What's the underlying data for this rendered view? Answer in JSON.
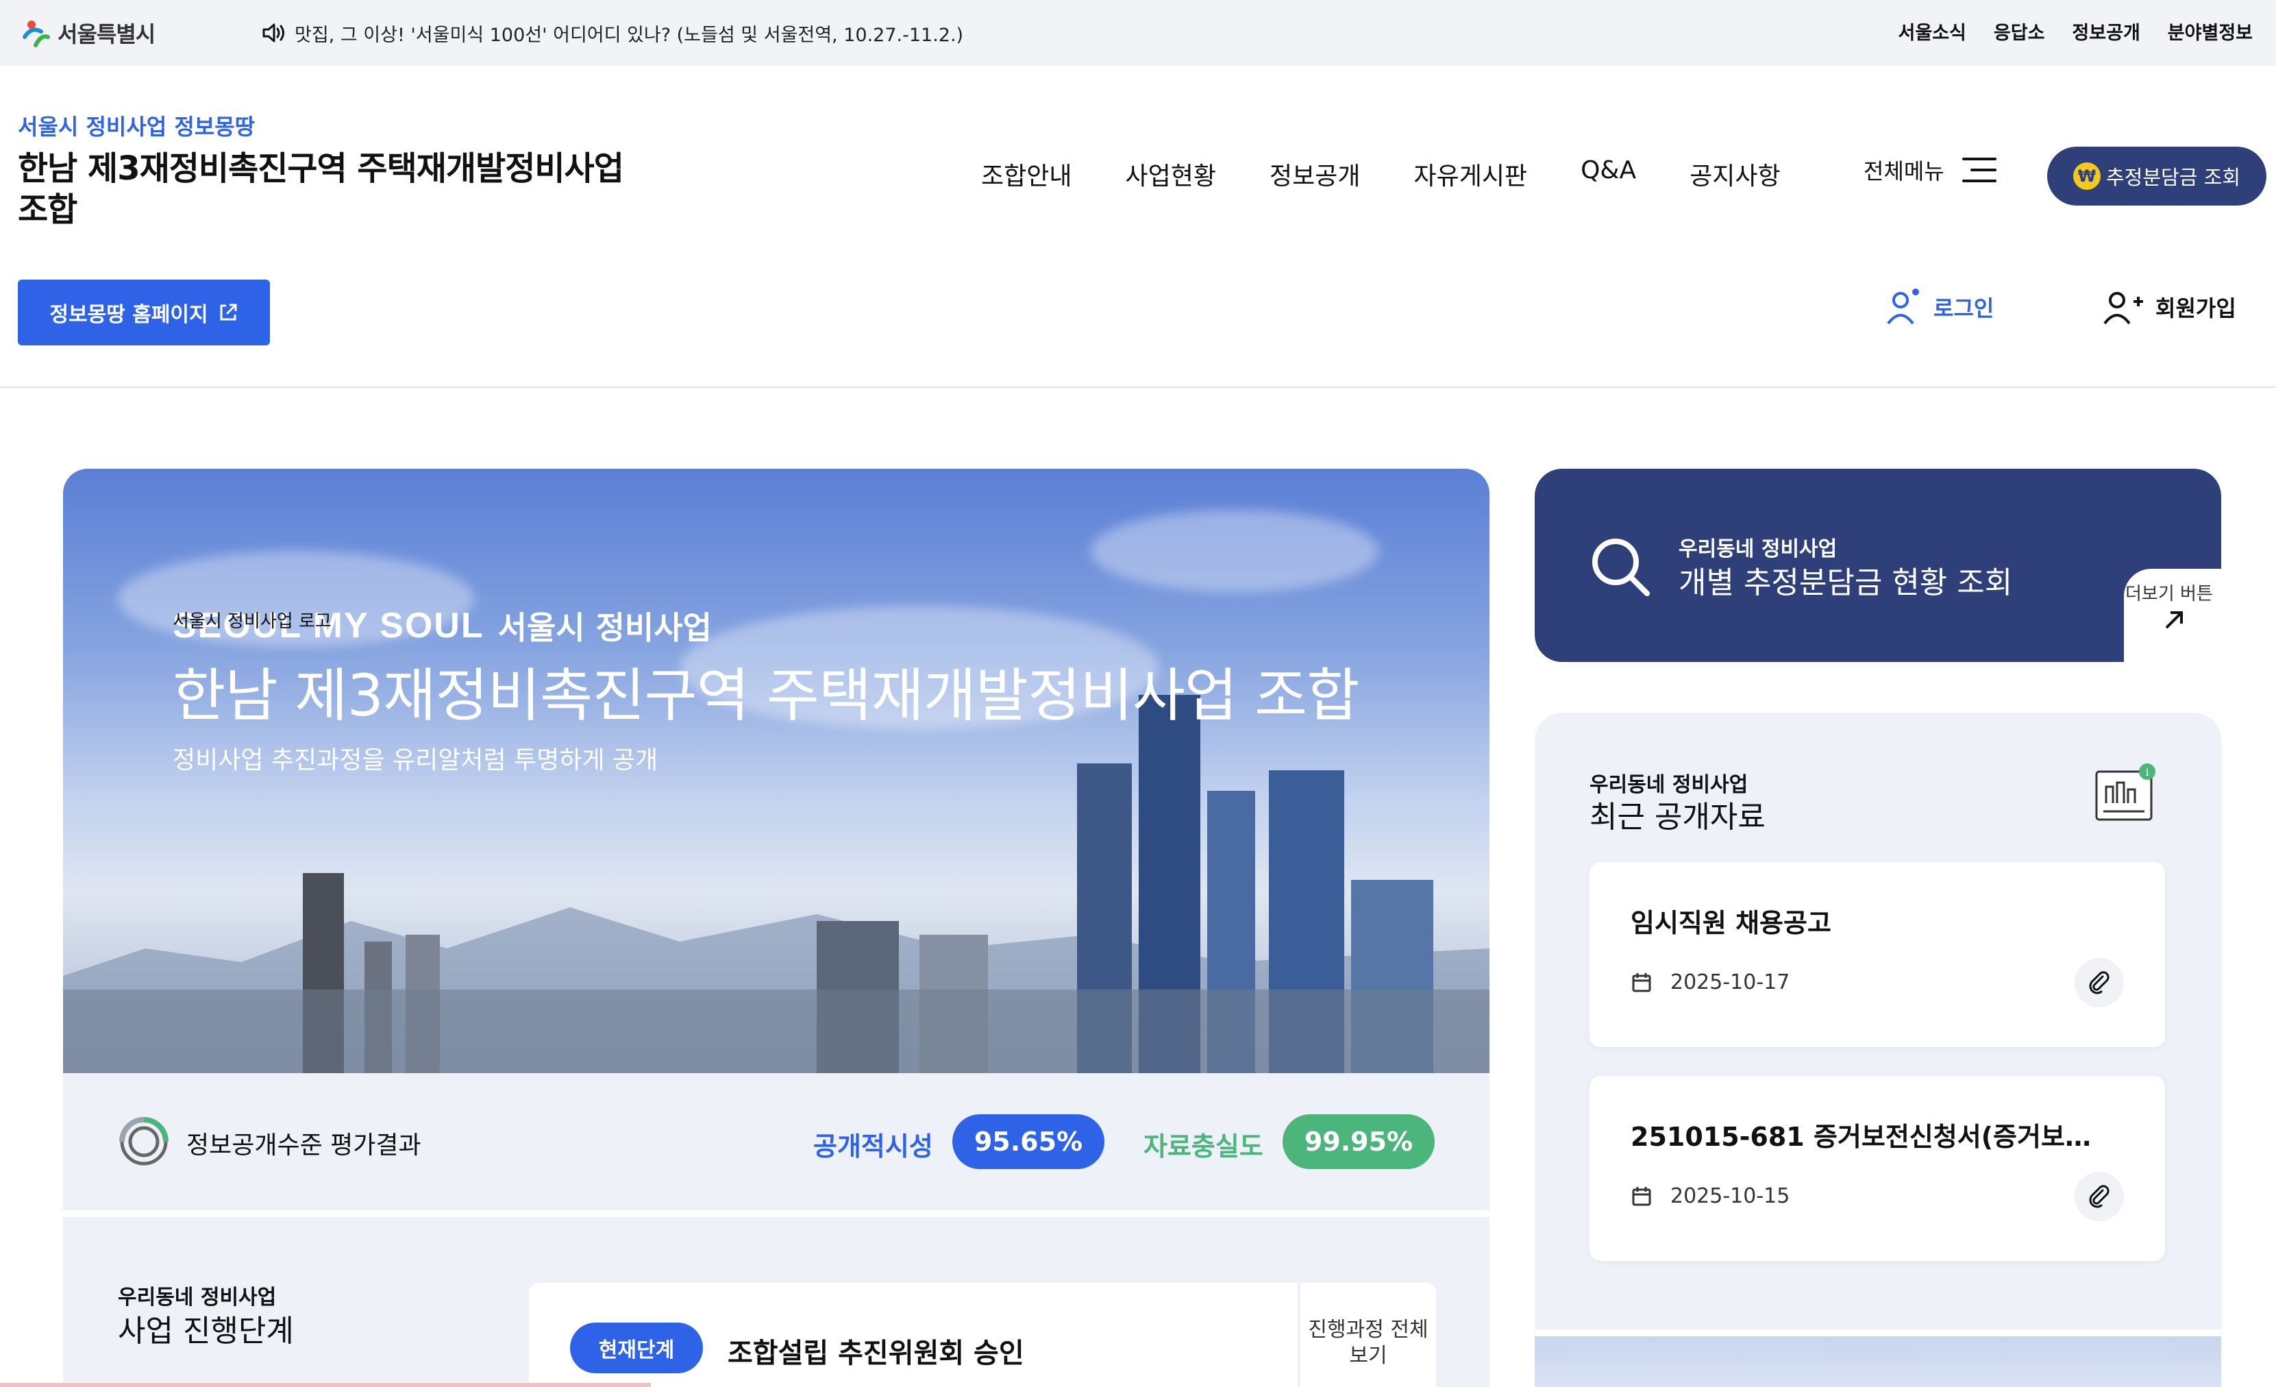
{
  "topbar": {
    "logo_text": "서울특별시",
    "notice": "맛집, 그 이상! '서울미식 100선' 어디어디 있나? (노들섬 및 서울전역, 10.27.-11.2.)",
    "utils": [
      "서울소식",
      "응답소",
      "정보공개",
      "분야별정보"
    ]
  },
  "header": {
    "site_sub": "서울시 정비사업 정보몽땅",
    "site_title": "한남 제3재정비촉진구역 주택재개발정비사업 조합",
    "nav": [
      "조합안내",
      "사업현황",
      "정보공개",
      "자유게시판",
      "Q&A",
      "공지사항"
    ],
    "all_menu": "전체메뉴",
    "estimate_button": "추정분담금 조회",
    "home_button": "정보몽땅 홈페이지",
    "login": "로그인",
    "signup": "회원가입"
  },
  "hero": {
    "logo_mark": "SEOUL MY SOUL",
    "logo_sub": "서울시 정비사업",
    "logo_alt": "서울시 정비사업 로고",
    "title": "한남 제3재정비촉진구역 주택재개발정비사업 조합",
    "desc": "정비사업 추진과정을 유리알처럼 투명하게 공개"
  },
  "evaluation": {
    "label": "정보공개수준 평가결과",
    "open_label": "공개적시성",
    "open_value": "95.65%",
    "full_label": "자료충실도",
    "full_value": "99.95%"
  },
  "stage": {
    "sub": "우리동네 정비사업",
    "title": "사업 진행단계",
    "badge": "현재단계",
    "current": "조합설립 추진위원회 승인",
    "view_all": "진행과정 전체보기"
  },
  "estimate_panel": {
    "sub": "우리동네 정비사업",
    "title": "개별 추정분담금 현황 조회",
    "more": "더보기 버튼"
  },
  "recent": {
    "sub": "우리동네 정비사업",
    "title": "최근 공개자료",
    "items": [
      {
        "title": "임시직원 채용공고",
        "date": "2025-10-17"
      },
      {
        "title": "251015-681 증거보전신청서(증거보전...",
        "date": "2025-10-15"
      }
    ]
  },
  "colors": {
    "primary": "#2e63e7",
    "navy": "#2f3f7a",
    "green": "#4bb57c",
    "panel_bg": "#eef2f8"
  }
}
